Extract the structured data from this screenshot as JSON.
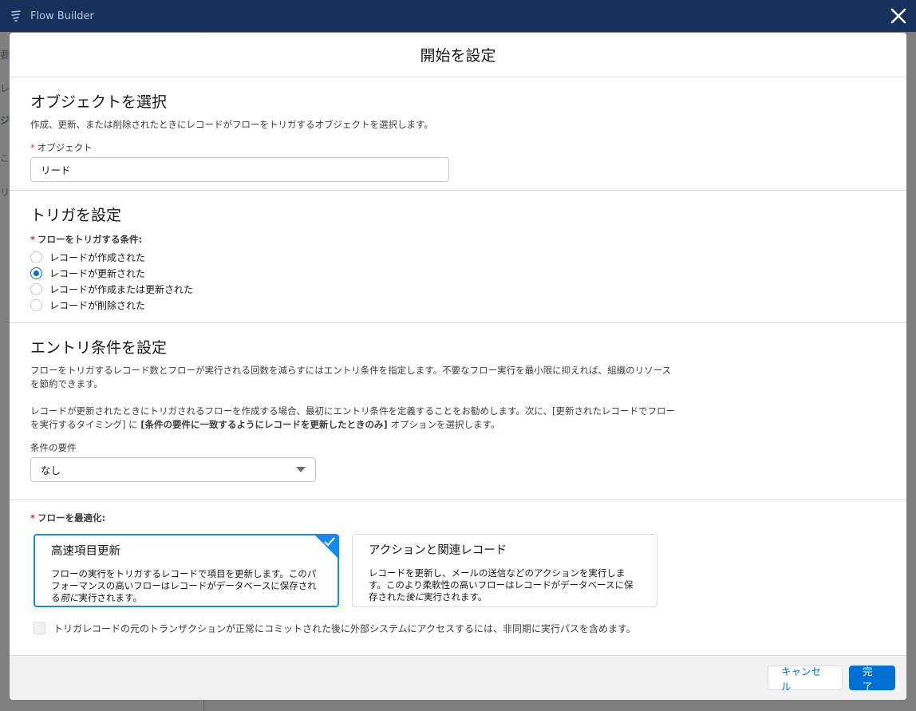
{
  "app": {
    "title": "Flow Builder"
  },
  "background": {
    "tabs": [
      "要",
      "レ",
      "ジ",
      "この",
      "リ"
    ]
  },
  "modal": {
    "title": "開始を設定",
    "object_section": {
      "heading": "オブジェクトを選択",
      "description": "作成、更新、または削除されたときにレコードがフローをトリガするオブジェクトを選択します。",
      "field_label": "オブジェクト",
      "field_value": "リード"
    },
    "trigger_section": {
      "heading": "トリガを設定",
      "field_label": "フローをトリガする条件:",
      "options": [
        {
          "label": "レコードが作成された",
          "checked": false
        },
        {
          "label": "レコードが更新された",
          "checked": true
        },
        {
          "label": "レコードが作成または更新された",
          "checked": false
        },
        {
          "label": "レコードが削除された",
          "checked": false
        }
      ]
    },
    "entry_section": {
      "heading": "エントリ条件を設定",
      "description1": "フローをトリガするレコード数とフローが実行される回数を減らすにはエントリ条件を指定します。不要なフロー実行を最小限に抑えれば、組織のリソースを節約できます。",
      "description2_pre": "レコードが更新されたときにトリガされるフローを作成する場合、最初にエントリ条件を定義することをお勧めします。次に、[更新されたレコードでフローを実行するタイミング] に ",
      "description2_bold": "[条件の要件に一致するようにレコードを更新したときのみ]",
      "description2_post": " オプションを選択します。",
      "select_label": "条件の要件",
      "select_value": "なし"
    },
    "optimize_section": {
      "label": "フローを最適化:",
      "cards": [
        {
          "title": "高速項目更新",
          "text_pre": "フローの実行をトリガするレコードで項目を更新します。このパフォーマンスの高いフローはレコードがデータベースに保存される",
          "text_em": "前に",
          "text_post": "実行されます。",
          "selected": true
        },
        {
          "title": "アクションと関連レコード",
          "text_pre": "レコードを更新し、メールの送信などのアクションを実行します。このより柔軟性の高いフローはレコードがデータベースに保存された",
          "text_em": "後に",
          "text_post": "実行されます。",
          "selected": false
        }
      ],
      "async_checkbox_label": "トリガレコードの元のトランザクションが正常にコミットされた後に外部システムにアクセスするには、非同期に実行パスを含めます。"
    },
    "footer": {
      "cancel_label": "キャンセル",
      "done_label": "完了"
    }
  },
  "colors": {
    "brand": "#0070d2",
    "selected_border": "#1589ee",
    "topbar": "#16325c",
    "required": "#c23934"
  }
}
